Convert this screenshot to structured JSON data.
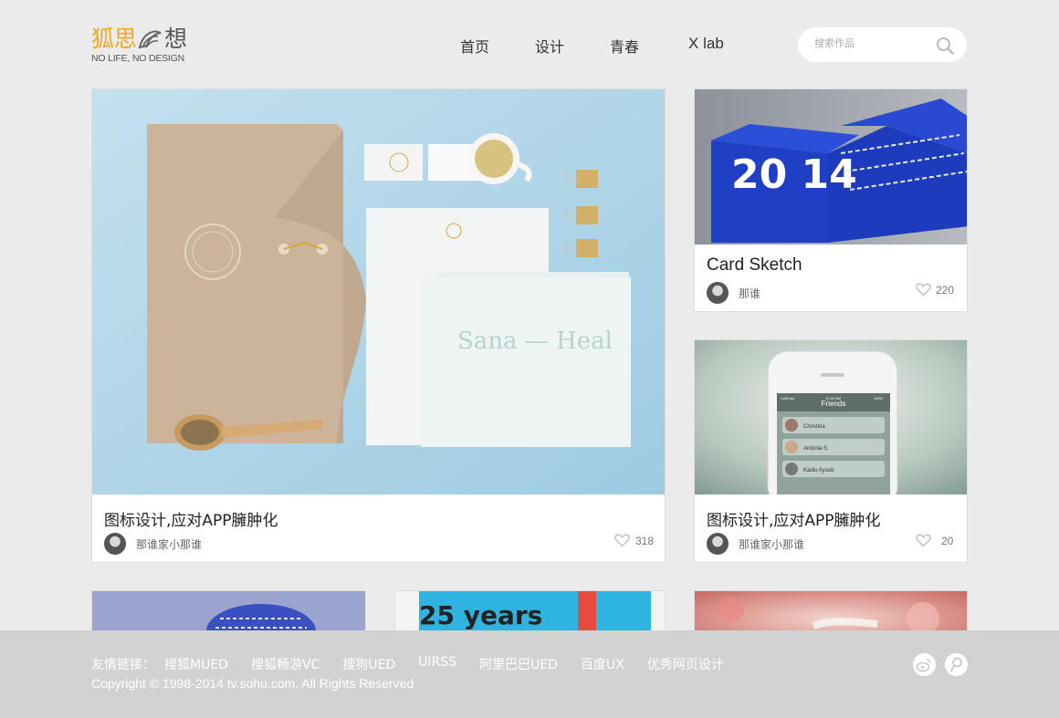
{
  "logo": {
    "cn_part1": "狐思",
    "cn_part2": "想",
    "tagline": "NO LIFE, NO DESIGN"
  },
  "nav": {
    "items": [
      "首页",
      "设计",
      "青春",
      "X lab"
    ]
  },
  "search": {
    "placeholder": "搜索作品",
    "icon": "search-icon"
  },
  "cards": [
    {
      "title": "图标设计,应对APP臃肿化",
      "author": "那谁家小那谁",
      "likes": "318",
      "image_text": "Sana — Heal"
    },
    {
      "title": "Card Sketch",
      "author": "那谁",
      "likes": "220",
      "image_text": "20 14"
    },
    {
      "title": "图标设计,应对APP臃肿化",
      "author": "那谁家小那谁",
      "likes": "20",
      "phone": {
        "carrier": "CellCars",
        "time": "12:42 AM",
        "battery": "100%",
        "screen_title": "Friends",
        "contacts": [
          "Christina",
          "Antonia S.",
          "Kaidu Ayoub"
        ]
      }
    },
    {
      "image_text": "25 years"
    }
  ],
  "footer": {
    "links_label": "友情链接：",
    "links": [
      "搜狐MUED",
      "搜狐畅游VC",
      "搜狗UED",
      "UIRSS",
      "阿里巴巴UED",
      "百度UX",
      "优秀网页设计"
    ],
    "copyright": "Copyright © 1998-2014 tv.sohu.com. All Rights Reserved",
    "social": [
      "weibo-icon",
      "tencent-weibo-icon"
    ]
  },
  "colors": {
    "accent": "#f0a81d",
    "background": "#ebebeb",
    "footer": "#d2d2d2"
  }
}
